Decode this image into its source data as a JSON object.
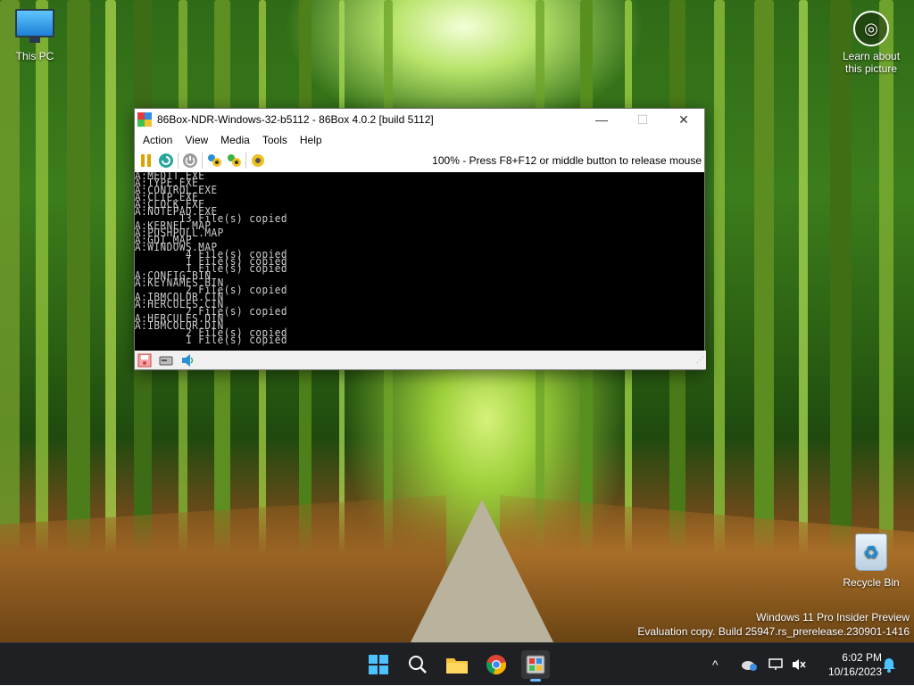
{
  "desktop": {
    "icons": {
      "this_pc": "This PC",
      "learn_line1": "Learn about",
      "learn_line2": "this picture",
      "recycle_bin": "Recycle Bin"
    },
    "watermark": {
      "line1": "Windows 11 Pro Insider Preview",
      "line2": "Evaluation copy. Build 25947.rs_prerelease.230901-1416"
    }
  },
  "window": {
    "title": "86Box-NDR-Windows-32-b5112 - 86Box 4.0.2 [build 5112]",
    "controls": {
      "minimize": "—",
      "maximize": "☐",
      "close": "✕"
    },
    "menu": [
      "Action",
      "View",
      "Media",
      "Tools",
      "Help"
    ],
    "toolbar": {
      "pause_icon": "pause-icon",
      "reset_icon": "reset-icon",
      "power_icon": "power-icon",
      "ctrl_alt_del_icon": "ctrl-alt-del-icon",
      "ctrl_alt_esc_icon": "ctrl-alt-esc-icon",
      "settings_icon": "settings-icon",
      "status_message": "100% - Press F8+F12 or middle button to release mouse"
    },
    "console_lines": [
      "A:MEDIT.EXE",
      "A:TYPE.EXE",
      "A:CONTROL.EXE",
      "A:CLIP.EXE",
      "A:CLOCK.EXE",
      "A:NOTEPAD.EXE",
      "       13 File(s) copied",
      "A:KERNEL.MAP",
      "A:PUSHPULL.MAP",
      "A:GDI.MAP",
      "A:WINDOWS.MAP",
      "        4 File(s) copied",
      "        1 File(s) copied",
      "        1 File(s) copied",
      "A:CONFIG.BIN",
      "A:KEYNAMES.BIN",
      "        2 File(s) copied",
      "A:IBMCOLOR.CIN",
      "A:HERCULES.CIN",
      "        2 File(s) copied",
      "A:HERCULES.DIN",
      "A:IBMCOLOR.DIN",
      "        2 File(s) copied",
      "        1 File(s) copied"
    ],
    "statusbar": {
      "floppy_icon": "floppy-drive-icon",
      "hdd_icon": "hard-disk-icon",
      "sound_icon": "sound-icon"
    }
  },
  "taskbar": {
    "apps": [
      "start-icon",
      "search-icon",
      "file-explorer-icon",
      "chrome-icon",
      "86box-icon"
    ],
    "tray": {
      "chevron": "^",
      "time": "6:02 PM",
      "date": "10/16/2023"
    }
  }
}
